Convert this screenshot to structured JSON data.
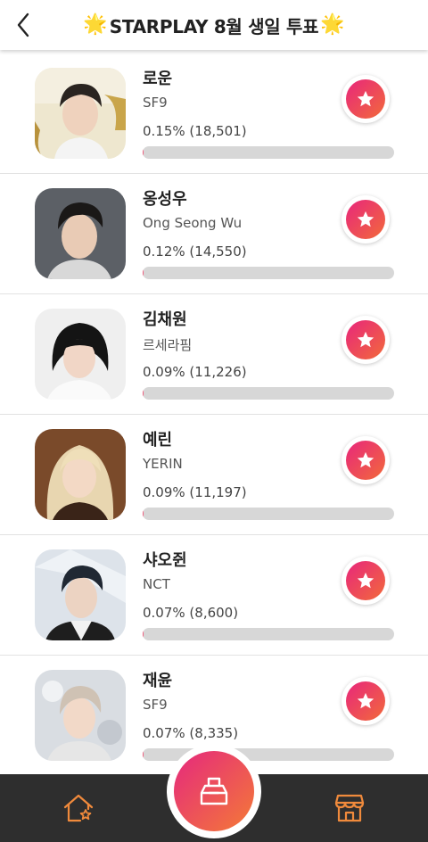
{
  "header": {
    "title": "STARPLAY 8월 생일 투표",
    "sparkle_left": "🌟",
    "sparkle_right": "🌟",
    "back_icon": "chevron-left-icon"
  },
  "candidates": [
    {
      "name": "로운",
      "group": "SF9",
      "stat": "0.15% (18,501)",
      "percent": 0.15
    },
    {
      "name": "옹성우",
      "group": "Ong Seong Wu",
      "stat": "0.12% (14,550)",
      "percent": 0.12
    },
    {
      "name": "김채원",
      "group": "르세라핌",
      "stat": "0.09% (11,226)",
      "percent": 0.09
    },
    {
      "name": "예린",
      "group": "YERIN",
      "stat": "0.09% (11,197)",
      "percent": 0.09
    },
    {
      "name": "샤오쥔",
      "group": "NCT",
      "stat": "0.07% (8,600)",
      "percent": 0.07
    },
    {
      "name": "재윤",
      "group": "SF9",
      "stat": "0.07% (8,335)",
      "percent": 0.07
    }
  ],
  "footer": {
    "home_icon": "home-star-icon",
    "center_icon": "ballot-box-icon",
    "store_icon": "store-icon"
  },
  "colors": {
    "accent_start": "#e8267c",
    "accent_end": "#f26a3a",
    "footer_bg": "#2e2e2e",
    "nav_icon": "#f08a3c",
    "bar_bg": "#d7d7d7"
  }
}
